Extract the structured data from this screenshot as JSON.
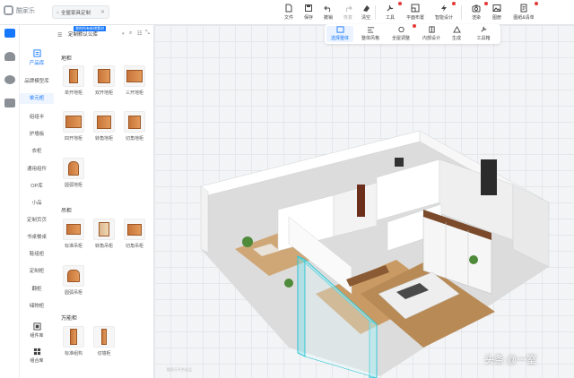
{
  "app": {
    "logo_text": "酷家乐"
  },
  "tab": {
    "title": "全屋家具定制"
  },
  "toolbar": {
    "items": [
      {
        "label": "文件",
        "icon": "file-icon"
      },
      {
        "label": "保存",
        "icon": "save-icon"
      },
      {
        "label": "撤销",
        "icon": "undo-icon"
      },
      {
        "label": "恢复",
        "icon": "redo-icon"
      },
      {
        "label": "清空",
        "icon": "clear-icon"
      },
      {
        "label": "工具",
        "icon": "tool-icon"
      },
      {
        "label": "平面布置",
        "icon": "floorplan-icon"
      },
      {
        "label": "智能设计",
        "icon": "smart-design-icon"
      },
      {
        "label": "渲染",
        "icon": "render-icon"
      },
      {
        "label": "图册",
        "icon": "album-icon"
      },
      {
        "label": "图纸&清单",
        "icon": "drawing-list-icon"
      }
    ]
  },
  "modebar": {
    "items": [
      {
        "label": "选择整体",
        "icon": "select-all-icon"
      },
      {
        "label": "整体风格",
        "icon": "style-icon"
      },
      {
        "label": "全屋调整",
        "icon": "adjust-icon"
      },
      {
        "label": "内部设计",
        "icon": "interior-icon"
      },
      {
        "label": "生成",
        "icon": "generate-icon"
      },
      {
        "label": "工具箱",
        "icon": "toolbox-icon"
      }
    ]
  },
  "categories": {
    "head": "产品库",
    "items": [
      "品牌模型库",
      "单元柜",
      "组组半",
      "护墙板",
      "衣柜",
      "通用组件",
      "OP库",
      "小品",
      "定制页页",
      "书桌餐桌",
      "鞋组柜",
      "定制柜",
      "翻柜",
      "储物柜"
    ],
    "selected": "单元柜",
    "bottom": [
      {
        "label": "组件库",
        "icon": "component-icon"
      },
      {
        "label": "组合库",
        "icon": "combo-icon"
      }
    ]
  },
  "library": {
    "select_value": "定制默认公库",
    "badge": "我的所有新增素材",
    "groups": [
      {
        "title": "地柜",
        "items": [
          "单开地柜",
          "双开地柜",
          "三开地柜",
          "四开地柜",
          "转角地柜",
          "切角地柜",
          "圆弧地柜"
        ]
      },
      {
        "title": "吊柜",
        "items": [
          "标准吊柜",
          "转角吊柜",
          "切角吊柜",
          "圆弧吊柜"
        ]
      },
      {
        "title": "万能柜",
        "items": [
          "标准组构",
          "切墙柜"
        ]
      }
    ]
  },
  "watermark": "头条 @一室",
  "scene_caption": "酷家乐平台出品",
  "colors": {
    "accent": "#1677ff",
    "wood": "#c8753a",
    "selection": "#2ec5d3"
  }
}
